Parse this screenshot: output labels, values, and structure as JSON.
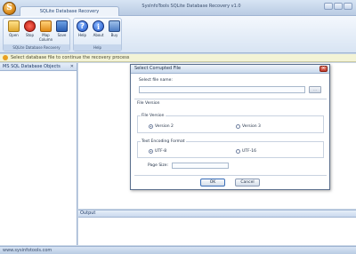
{
  "window": {
    "title": "SysInfoTools SQLite Database Recovery v1.0",
    "ribbon_tab": "SQLite Database Recovery"
  },
  "ribbon": {
    "groups": [
      {
        "label": "SQLite Database Recovery",
        "buttons": [
          {
            "label": "Open",
            "icon": "open-folder-icon"
          },
          {
            "label": "Stop",
            "icon": "stop-icon"
          },
          {
            "label": "Map Column",
            "icon": "map-column-icon"
          },
          {
            "label": "Save",
            "icon": "save-icon"
          }
        ]
      },
      {
        "label": "Help",
        "buttons": [
          {
            "label": "Help",
            "icon": "help-icon"
          },
          {
            "label": "About",
            "icon": "about-icon"
          },
          {
            "label": "Buy",
            "icon": "buy-icon"
          }
        ]
      }
    ]
  },
  "infobar": {
    "text": "Select database file to continue the recovery process"
  },
  "sidebar": {
    "header": "MS SQL Database Objects",
    "pin": "✕"
  },
  "output": {
    "header": "Output"
  },
  "status": {
    "text": "www.sysinfotools.com"
  },
  "dialog": {
    "title": "Select Corrupted File",
    "select_label": "Select file name:",
    "file_value": "",
    "browse_label": "...",
    "file_version_section": "File Version",
    "file_version_group": "File Version",
    "versions": [
      {
        "label": "Version 2",
        "selected": true
      },
      {
        "label": "Version 3",
        "selected": false
      }
    ],
    "encoding_group": "Text Encoding Format",
    "encodings": [
      {
        "label": "UTF-8",
        "selected": true
      },
      {
        "label": "UTF-16",
        "selected": false
      }
    ],
    "page_size_label": "Page Size:",
    "page_size_value": "",
    "ok_label": "OK",
    "cancel_label": "Cancel"
  }
}
